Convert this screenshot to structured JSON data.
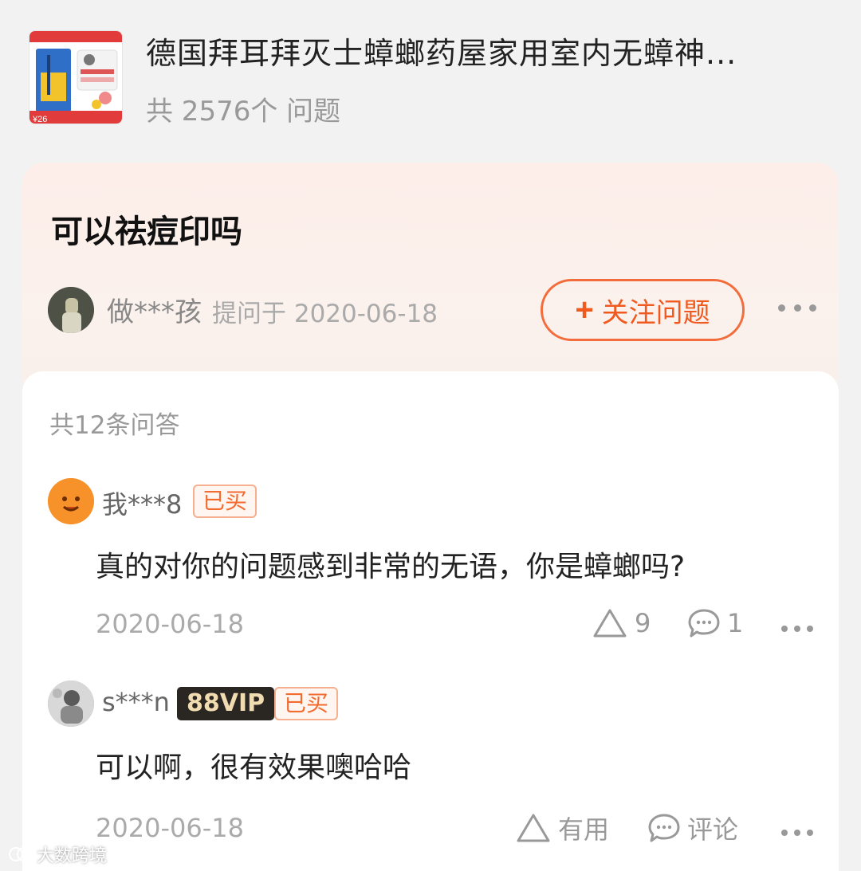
{
  "product": {
    "title": "德国拜耳拜灭士蟑螂药屋家用室内无蟑神...",
    "question_count": "共 2576个 问题",
    "thumb_price": "¥26"
  },
  "question": {
    "title": "可以祛痘印吗",
    "asker": "做***孩",
    "asked_on": "提问于 2020-06-18",
    "follow_label": "关注问题"
  },
  "answers": {
    "count_label": "共12条问答",
    "items": [
      {
        "user": "我***8",
        "bought_badge": "已买",
        "text": "真的对你的问题感到非常的无语，你是蟑螂吗?",
        "date": "2020-06-18",
        "likes": "9",
        "comments": "1"
      },
      {
        "user": "s***n",
        "vip_badge": "88VIP",
        "bought_badge": "已买",
        "text": "可以啊，很有效果噢哈哈",
        "date": "2020-06-18",
        "useful_label": "有用",
        "comment_label": "评论"
      }
    ]
  },
  "watermark": "大数跨境",
  "colors": {
    "accent": "#f05a1e",
    "card_bg": "#fdeee9",
    "page_bg": "#f2f2f2"
  }
}
